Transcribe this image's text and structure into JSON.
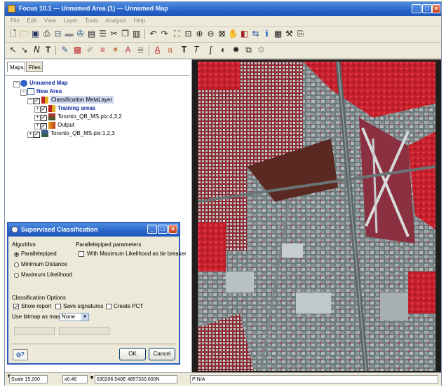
{
  "window": {
    "title": "Focus 10.1 — Unnamed Area (1) — Unnamed Map"
  },
  "menubar": {
    "items": [
      "File",
      "Edit",
      "View",
      "Layer",
      "Tools",
      "Analysis",
      "Help"
    ]
  },
  "tabs": [
    {
      "label": "Maps",
      "active": true
    },
    {
      "label": "Files",
      "active": false
    }
  ],
  "tree": {
    "map": "Unnamed Map",
    "area": "New Area",
    "metalayer": "Classification MetaLayer",
    "training": "Training areas",
    "layer1": "Toronto_QB_MS.pix:4,3,2",
    "output": "Output",
    "layer2": "Toronto_QB_MS.pix:1,2,3"
  },
  "dialog": {
    "title": "Supervised Classification",
    "algorithm_label": "Algorithm",
    "algorithms": [
      "Parallelepiped",
      "Minimum Distance",
      "Maximum Likelihood"
    ],
    "params_label": "Parallelepiped parameters",
    "tie_breaker": "With Maximum Likelihood as tie breaker",
    "options_label": "Classification Options",
    "show_report": "Show report",
    "save_signatures": "Save signatures",
    "create_pct": "Create PCT",
    "bitmap_label": "Use bitmap as mask",
    "bitmap_value": "None",
    "ok": "OK",
    "cancel": "Cancel"
  },
  "status": {
    "scale": "Scale 15,200",
    "zoom": "x0.46",
    "coords": "630206.540E 4857330.000N",
    "value": "P:N/A"
  },
  "colors": {
    "title_blue": "#2764c8",
    "tree_blue": "#1030a0",
    "vegetation_red": "#c8202c"
  }
}
